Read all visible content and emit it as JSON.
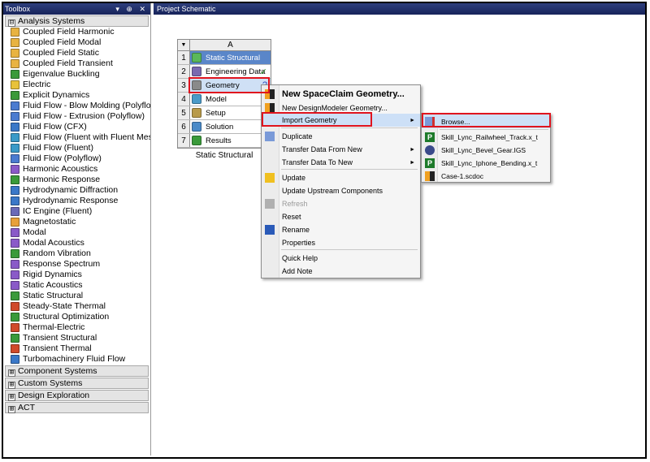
{
  "toolbox": {
    "title": "Toolbox",
    "controls": "▾ ⊕ ✕",
    "groups": {
      "analysis": {
        "label": "Analysis Systems",
        "expander": "⊟"
      },
      "component": {
        "label": "Component Systems",
        "expander": "⊞"
      },
      "custom": {
        "label": "Custom Systems",
        "expander": "⊞"
      },
      "design": {
        "label": "Design Exploration",
        "expander": "⊞"
      },
      "act": {
        "label": "ACT",
        "expander": "⊞"
      }
    },
    "items": [
      {
        "label": "Coupled Field Harmonic",
        "color": "#e8b341"
      },
      {
        "label": "Coupled Field Modal",
        "color": "#e8b341"
      },
      {
        "label": "Coupled Field Static",
        "color": "#e8b341"
      },
      {
        "label": "Coupled Field Transient",
        "color": "#e8b341"
      },
      {
        "label": "Eigenvalue Buckling",
        "color": "#3a9a3a"
      },
      {
        "label": "Electric",
        "color": "#e8c23a"
      },
      {
        "label": "Explicit Dynamics",
        "color": "#3a9a3a"
      },
      {
        "label": "Fluid Flow - Blow Molding (Polyflow)",
        "color": "#4a7bd0"
      },
      {
        "label": "Fluid Flow - Extrusion (Polyflow)",
        "color": "#4a7bd0"
      },
      {
        "label": "Fluid Flow (CFX)",
        "color": "#3a78c8"
      },
      {
        "label": "Fluid Flow (Fluent with Fluent Meshing)",
        "color": "#3a9ac8"
      },
      {
        "label": "Fluid Flow (Fluent)",
        "color": "#3a9ac8"
      },
      {
        "label": "Fluid Flow (Polyflow)",
        "color": "#4a7bd0"
      },
      {
        "label": "Harmonic Acoustics",
        "color": "#8a5ac8"
      },
      {
        "label": "Harmonic Response",
        "color": "#3a9a3a"
      },
      {
        "label": "Hydrodynamic Diffraction",
        "color": "#3a78c8"
      },
      {
        "label": "Hydrodynamic Response",
        "color": "#3a78c8"
      },
      {
        "label": "IC Engine (Fluent)",
        "color": "#6a6ab8"
      },
      {
        "label": "Magnetostatic",
        "color": "#e8a03a"
      },
      {
        "label": "Modal",
        "color": "#8a5ac8"
      },
      {
        "label": "Modal Acoustics",
        "color": "#8a5ac8"
      },
      {
        "label": "Random Vibration",
        "color": "#3a9a3a"
      },
      {
        "label": "Response Spectrum",
        "color": "#8a5ac8"
      },
      {
        "label": "Rigid Dynamics",
        "color": "#8a5ac8"
      },
      {
        "label": "Static Acoustics",
        "color": "#8a5ac8"
      },
      {
        "label": "Static Structural",
        "color": "#3a9a3a"
      },
      {
        "label": "Steady-State Thermal",
        "color": "#d04a2a"
      },
      {
        "label": "Structural Optimization",
        "color": "#3a9a3a"
      },
      {
        "label": "Thermal-Electric",
        "color": "#d04a2a"
      },
      {
        "label": "Transient Structural",
        "color": "#3a9a3a"
      },
      {
        "label": "Transient Thermal",
        "color": "#d04a2a"
      },
      {
        "label": "Turbomachinery Fluid Flow",
        "color": "#3a78c8"
      }
    ]
  },
  "schematic": {
    "title": "Project Schematic",
    "system": {
      "column": "A",
      "corner": "▼",
      "label": "Static Structural",
      "rows": [
        {
          "num": "1",
          "label": "Static Structural",
          "color": "#5ab85a",
          "status": ""
        },
        {
          "num": "2",
          "label": "Engineering Data",
          "color": "#7a6ab0",
          "status": "✓"
        },
        {
          "num": "3",
          "label": "Geometry",
          "color": "#8a8a8a",
          "status": "?"
        },
        {
          "num": "4",
          "label": "Model",
          "color": "#4a9ac8",
          "status": ""
        },
        {
          "num": "5",
          "label": "Setup",
          "color": "#b89a4a",
          "status": ""
        },
        {
          "num": "6",
          "label": "Solution",
          "color": "#4a8ac8",
          "status": ""
        },
        {
          "num": "7",
          "label": "Results",
          "color": "#3a9a3a",
          "status": ""
        }
      ]
    }
  },
  "context_menu": {
    "items": [
      {
        "label": "New SpaceClaim Geometry...",
        "icon": "spaceclaim-icon"
      },
      {
        "label": "New DesignModeler Geometry...",
        "icon": "designmodeler-icon"
      },
      {
        "label": "Import Geometry",
        "arrow": "►"
      },
      {
        "label": "Duplicate",
        "icon": "duplicate-icon"
      },
      {
        "label": "Transfer Data From New",
        "arrow": "►"
      },
      {
        "label": "Transfer Data To New",
        "arrow": "►"
      },
      {
        "label": "Update",
        "icon": "lightning-icon"
      },
      {
        "label": "Update Upstream Components"
      },
      {
        "label": "Refresh",
        "icon": "refresh-icon"
      },
      {
        "label": "Reset"
      },
      {
        "label": "Rename",
        "icon": "rename-icon"
      },
      {
        "label": "Properties"
      },
      {
        "label": "Quick Help"
      },
      {
        "label": "Add Note"
      }
    ]
  },
  "submenu": {
    "items": [
      {
        "label": "Browse...",
        "icon": "browse-icon"
      },
      {
        "label": "Skill_Lync_Railwheel_Track.x_t",
        "icon": "parasolid-icon",
        "badge": "P"
      },
      {
        "label": "Skill_Lync_Bevel_Gear.IGS",
        "icon": "iges-icon"
      },
      {
        "label": "Skill_Lync_Iphone_Bending.x_t",
        "icon": "parasolid-icon",
        "badge": "P"
      },
      {
        "label": "Case-1.scdoc",
        "icon": "spaceclaim-icon"
      }
    ]
  }
}
